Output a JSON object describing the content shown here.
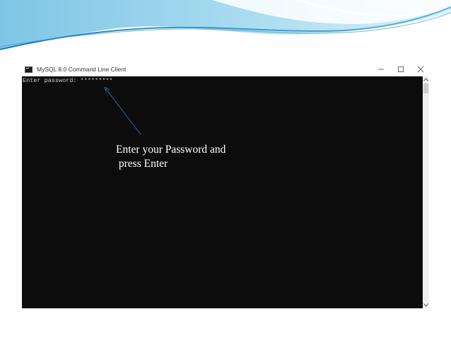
{
  "window": {
    "title": "MySQL 8.0 Command Line Client",
    "icon": "console-app-icon",
    "controls": [
      "minimize-icon",
      "maximize-icon",
      "close-icon"
    ]
  },
  "console": {
    "line": "Enter password: *********"
  },
  "annotation": {
    "line1": "Enter your Password and",
    "line2": " press Enter"
  },
  "colors": {
    "console_bg": "#0c0c0c",
    "console_text": "#d0d0d0",
    "arrow": "#2b6cb0",
    "wave_light": "#bfe3f2",
    "wave_dark": "#2f87b8"
  }
}
